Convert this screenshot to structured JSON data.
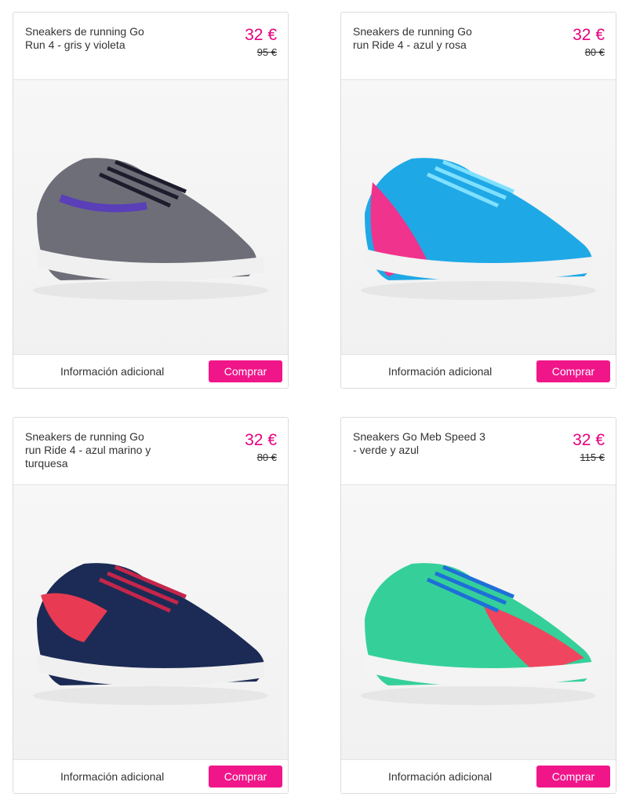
{
  "products": [
    {
      "name": "Sneakers de running Go Run 4 - gris y violeta",
      "price": "32 €",
      "old_price": "95 €",
      "info_label": "Información adicional",
      "buy_label": "Comprar",
      "colors": {
        "upper": "#6e6e78",
        "accent": "#5a3fb8",
        "sole": "#f0f0f0",
        "laces": "#1c1c2c"
      }
    },
    {
      "name": "Sneakers de running Go run Ride 4 - azul y rosa",
      "price": "32 €",
      "old_price": "80 €",
      "info_label": "Información adicional",
      "buy_label": "Comprar",
      "colors": {
        "upper": "#1fa8e6",
        "accent": "#f0338c",
        "sole": "#f2f2f2",
        "laces": "#7fe0ff"
      }
    },
    {
      "name": "Sneakers de running Go run Ride 4 - azul marino y turquesa",
      "price": "32 €",
      "old_price": "80 €",
      "info_label": "Información adicional",
      "buy_label": "Comprar",
      "colors": {
        "upper": "#1c2b55",
        "accent": "#e83a52",
        "sole": "#f0f0f0",
        "laces": "#c4264a"
      }
    },
    {
      "name": "Sneakers Go Meb Speed 3 - verde y azul",
      "price": "32 €",
      "old_price": "115 €",
      "info_label": "Información adicional",
      "buy_label": "Comprar",
      "colors": {
        "upper": "#35d09a",
        "accent": "#f0455e",
        "sole": "#f4f4f4",
        "laces": "#1e6fd8"
      }
    }
  ]
}
